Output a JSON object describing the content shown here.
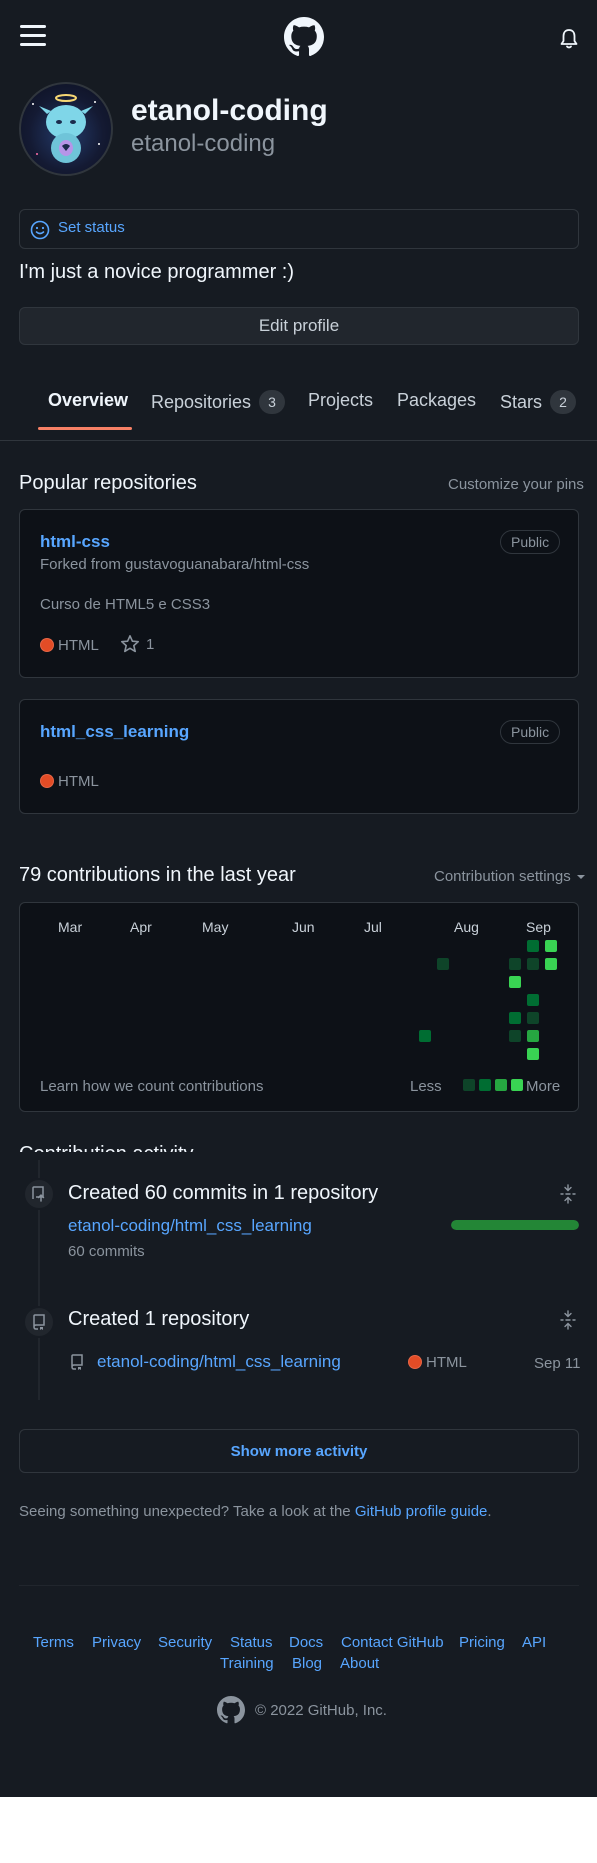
{
  "header": {
    "menu_icon": "hamburger-icon",
    "logo_icon": "github-logo-icon",
    "bell_icon": "bell-icon"
  },
  "profile": {
    "display_name": "etanol-coding",
    "username": "etanol-coding",
    "set_status": "Set status",
    "bio": "I'm just a novice programmer :)",
    "edit_profile": "Edit profile"
  },
  "tabs": [
    {
      "label": "Overview",
      "selected": true
    },
    {
      "label": "Repositories",
      "count": "3"
    },
    {
      "label": "Projects"
    },
    {
      "label": "Packages"
    },
    {
      "label": "Stars",
      "count": "2"
    }
  ],
  "popular": {
    "title": "Popular repositories",
    "customize": "Customize your pins",
    "repos": [
      {
        "name": "html-css",
        "visibility": "Public",
        "forked": "Forked from gustavoguanabara/html-css",
        "description": "Curso de HTML5 e CSS3",
        "language": "HTML",
        "stars": "1"
      },
      {
        "name": "html_css_learning",
        "visibility": "Public",
        "language": "HTML"
      }
    ]
  },
  "contributions": {
    "title": "79 contributions in the last year",
    "settings": "Contribution settings",
    "months": [
      "Mar",
      "Apr",
      "May",
      "Jun",
      "Jul",
      "Aug",
      "Sep"
    ],
    "learn": "Learn how we count contributions",
    "less": "Less",
    "more": "More",
    "colors": {
      "level1": "#0e4429",
      "level2": "#006d32",
      "level3": "#26a641",
      "level4": "#39d353"
    }
  },
  "activity": {
    "heading": "Contribution activity",
    "items": [
      {
        "title": "Created 60 commits in 1 repository",
        "repo": "etanol-coding/html_css_learning",
        "detail": "60 commits",
        "progress": 1.0
      },
      {
        "title": "Created 1 repository",
        "repo": "etanol-coding/html_css_learning",
        "language": "HTML",
        "date": "Sep 11"
      }
    ],
    "show_more": "Show more activity",
    "unexpected": "Seeing something unexpected? Take a look at the",
    "guide_link": "GitHub profile guide",
    "guide_period": "."
  },
  "footer": {
    "links": [
      "Terms",
      "Privacy",
      "Security",
      "Status",
      "Docs",
      "Contact GitHub",
      "Pricing",
      "API",
      "Training",
      "Blog",
      "About"
    ],
    "copyright": "© 2022 GitHub, Inc."
  }
}
